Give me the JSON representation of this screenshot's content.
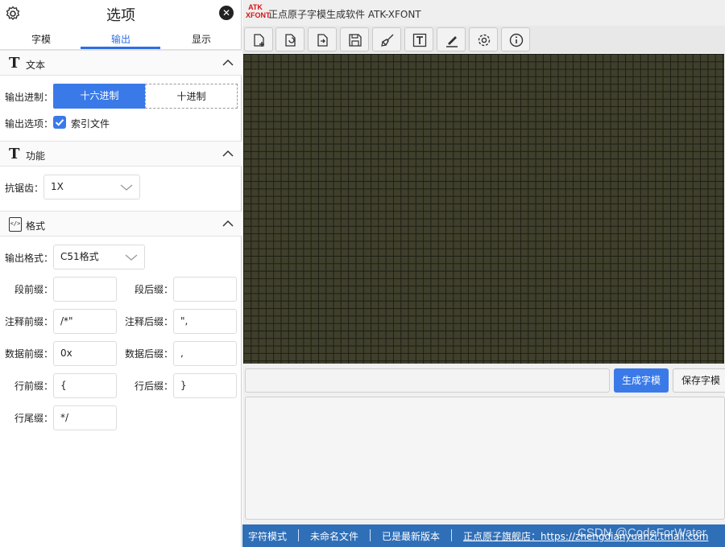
{
  "panel": {
    "title": "选项",
    "tabs": [
      {
        "label": "字模"
      },
      {
        "label": "输出",
        "active": true
      },
      {
        "label": "显示"
      }
    ],
    "sections": {
      "text": {
        "title": "文本",
        "icon_glyph": "T",
        "output_base_label": "输出进制：",
        "base_options": [
          "十六进制",
          "十进制"
        ],
        "base_selected": "十六进制",
        "output_options_label": "输出选项：",
        "index_file_label": "索引文件",
        "index_file_checked": true
      },
      "function": {
        "title": "功能",
        "icon_glyph": "T",
        "antialias_label": "抗锯齿：",
        "antialias_value": "1X"
      },
      "format": {
        "title": "格式",
        "icon_glyph": "</>",
        "output_format_label": "输出格式：",
        "output_format_value": "C51格式",
        "fields": {
          "seg_prefix": {
            "label": "段前缀：",
            "value": ""
          },
          "seg_suffix": {
            "label": "段后缀：",
            "value": ""
          },
          "comment_prefix": {
            "label": "注释前缀：",
            "value": "/*\""
          },
          "comment_suffix": {
            "label": "注释后缀：",
            "value": "\","
          },
          "data_prefix": {
            "label": "数据前缀：",
            "value": "0x"
          },
          "data_suffix": {
            "label": "数据后缀：",
            "value": ","
          },
          "line_prefix": {
            "label": "行前缀：",
            "value": "{"
          },
          "line_suffix": {
            "label": "行后缀：",
            "value": "}"
          },
          "line_tail": {
            "label": "行尾缀：",
            "value": "*/"
          }
        }
      }
    }
  },
  "app": {
    "logo_text_top": "ATK",
    "logo_text_bottom": "XFONT",
    "title": "正点原子字模生成软件 ATK-XFONT",
    "toolbar_icons": [
      "new-file-icon",
      "open-file-icon",
      "export-file-icon",
      "save-icon",
      "brush-icon",
      "text-icon",
      "pen-icon",
      "settings-icon",
      "info-icon"
    ],
    "generate_label": "生成字模",
    "save_label": "保存字模",
    "input_value": "",
    "colors": {
      "accent": "#3a7ae8",
      "status_bg": "#2f6fb8",
      "canvas_bg": "#3f3f2c"
    }
  },
  "status": {
    "mode": "字符模式",
    "file": "未命名文件",
    "version": "已是最新版本",
    "store": "正点原子旗舰店：https://zhengdianyuanzi.tmall.com"
  },
  "watermark": "CSDN @CodeForWater"
}
